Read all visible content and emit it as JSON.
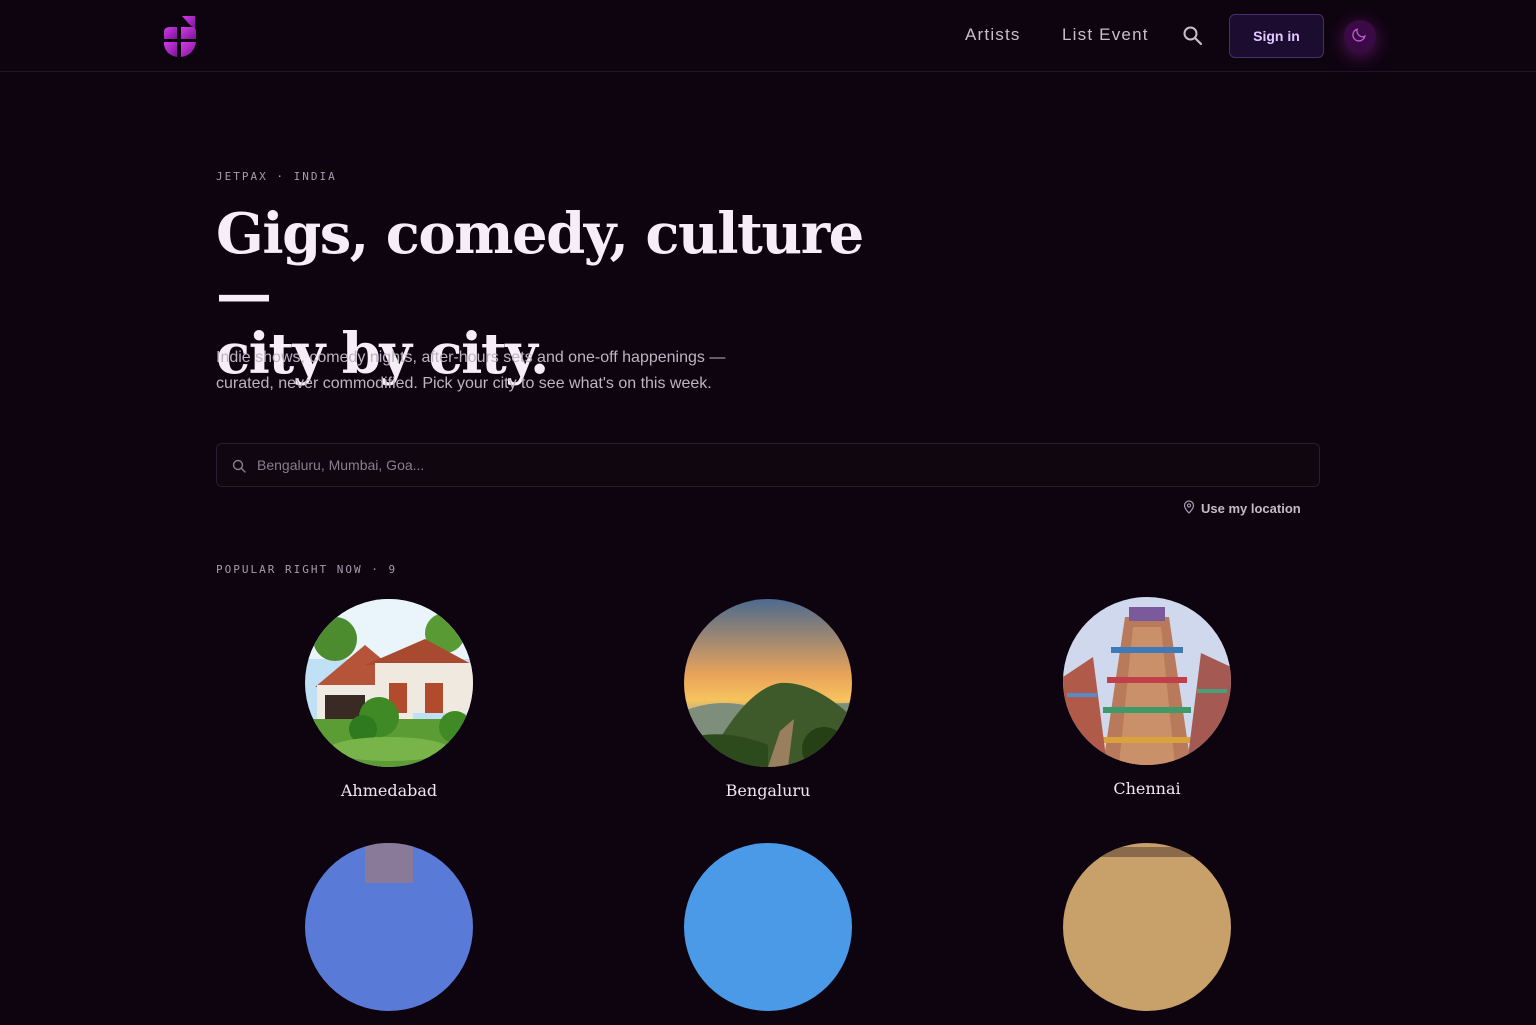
{
  "nav": {
    "links": [
      "Artists",
      "List Event"
    ],
    "sign_in": "Sign in"
  },
  "hero": {
    "eyebrow": "JETPAX · INDIA",
    "headline_line1": "Gigs, comedy, culture —",
    "headline_line2": "city by city.",
    "subtitle_line1": "Indie shows, comedy nights, after-hours sets and one-off happenings —",
    "subtitle_line2": "curated, never commodified. Pick your city to see what's on this week."
  },
  "search": {
    "placeholder": "Bengaluru, Mumbai, Goa...",
    "value": ""
  },
  "location": {
    "label": "Use my location"
  },
  "popular": {
    "label": "POPULAR RIGHT NOW · 9",
    "cities": [
      {
        "name": "Ahmedabad"
      },
      {
        "name": "Bengaluru"
      },
      {
        "name": "Chennai"
      },
      {
        "name": ""
      },
      {
        "name": ""
      },
      {
        "name": ""
      }
    ]
  },
  "colors": {
    "background": "#0e0410",
    "accent": "#b01fd0",
    "signin_text": "#e3c8ff"
  },
  "icons": {
    "logo": "jetpax-logo",
    "search": "search-icon",
    "theme": "moon-icon",
    "location": "location-pin-icon"
  }
}
